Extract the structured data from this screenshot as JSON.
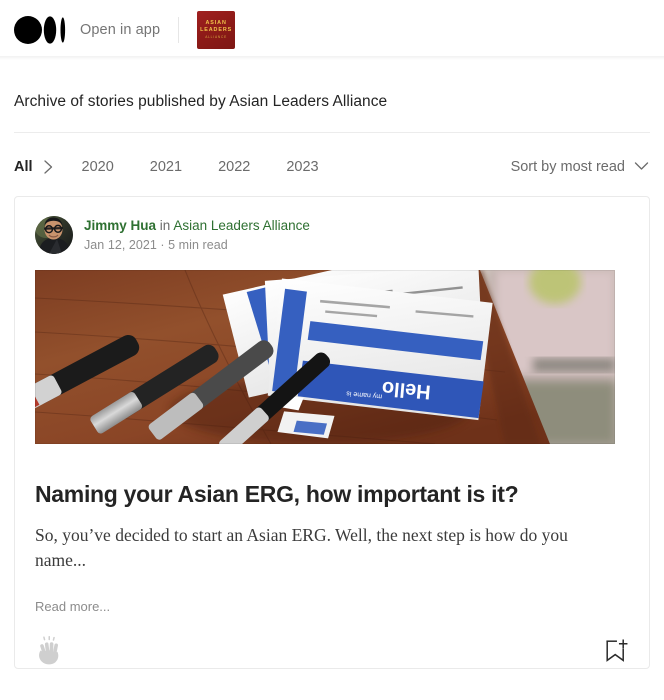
{
  "topbar": {
    "logo_icon": "medium-logo-icon",
    "open_in_app": "Open in app",
    "publication_badge": {
      "line1": "ASIAN",
      "line2": "LEADERS",
      "line3": "ALLIANCE",
      "bg_color": "#8f1b18",
      "text_color": "#f0c24a"
    }
  },
  "page": {
    "archive_title": "Archive of stories published by Asian Leaders Alliance"
  },
  "filters": {
    "years": [
      {
        "label": "All",
        "active": true
      },
      {
        "label": "2020",
        "active": false
      },
      {
        "label": "2021",
        "active": false
      },
      {
        "label": "2022",
        "active": false
      },
      {
        "label": "2023",
        "active": false
      }
    ],
    "chevron_right_icon": "chevron-right-icon",
    "sort": {
      "label": "Sort by most read",
      "chevron_icon": "chevron-down-icon"
    }
  },
  "article": {
    "author": "Jimmy Hua",
    "connector": "in",
    "publication": "Asian Leaders Alliance",
    "date": "Jan 12, 2021",
    "separator": "·",
    "read_time": "5 min read",
    "meta_line": "Jan 12, 2021 · 5 min read",
    "title": "Naming your Asian ERG, how important is it?",
    "excerpt": "So, you’ve decided to start an Asian ERG. Well, the next step is how do you name...",
    "read_more": "Read more...",
    "avatar_icon": "author-avatar",
    "hero_image_alt": "Hello my name is name tags with blue bands on a wooden desk beside markers",
    "clap_icon": "clap-icon",
    "bookmark_icon": "bookmark-add-icon"
  },
  "colors": {
    "accent_green": "#2e7031",
    "text_primary": "#242424",
    "text_muted": "#6b6b6b",
    "border": "#eaeaea",
    "brand_red": "#8f1b18"
  }
}
